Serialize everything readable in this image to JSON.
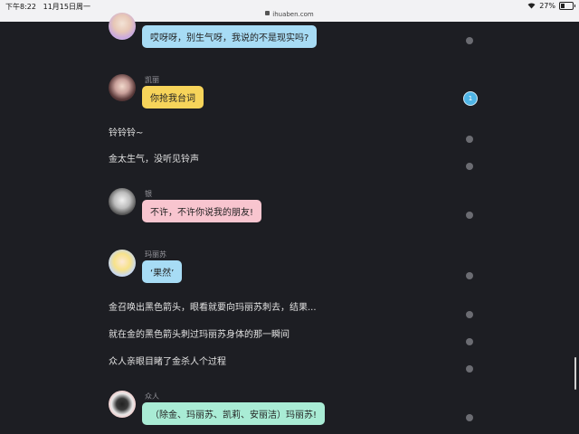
{
  "status_bar": {
    "time": "下午8:22",
    "date": "11月15日周一",
    "url": "ihuaben.com",
    "battery": "27%"
  },
  "messages": [
    {
      "type": "bubble",
      "speaker": "",
      "text": "哎呀呀，别生气呀，我说的不是现实吗?",
      "color": "#a7dcf5"
    },
    {
      "type": "bubble",
      "speaker": "凯丽",
      "text": "你抢我台词",
      "color": "#f7d45a"
    },
    {
      "type": "narration",
      "text": "铃铃铃~"
    },
    {
      "type": "narration",
      "text": "金太生气，没听见铃声"
    },
    {
      "type": "bubble",
      "speaker": "银",
      "text": "不许，不许你说我的朋友!",
      "color": "#f8c5cf"
    },
    {
      "type": "bubble",
      "speaker": "玛丽苏",
      "text": "‘果然’",
      "color": "#a7dcf5"
    },
    {
      "type": "narration",
      "text": "金召唤出黑色箭头，眼看就要向玛丽苏刺去，结果..."
    },
    {
      "type": "narration",
      "text": "就在金的黑色箭头刺过玛丽苏身体的那一瞬间"
    },
    {
      "type": "narration",
      "text": "众人亲眼目睹了金杀人个过程"
    },
    {
      "type": "bubble",
      "speaker": "众人",
      "text": "（除金、玛丽苏、凯莉、安丽洁）玛丽苏!",
      "color": "#a9ecd5"
    }
  ],
  "progress": {
    "active_label": "1"
  }
}
